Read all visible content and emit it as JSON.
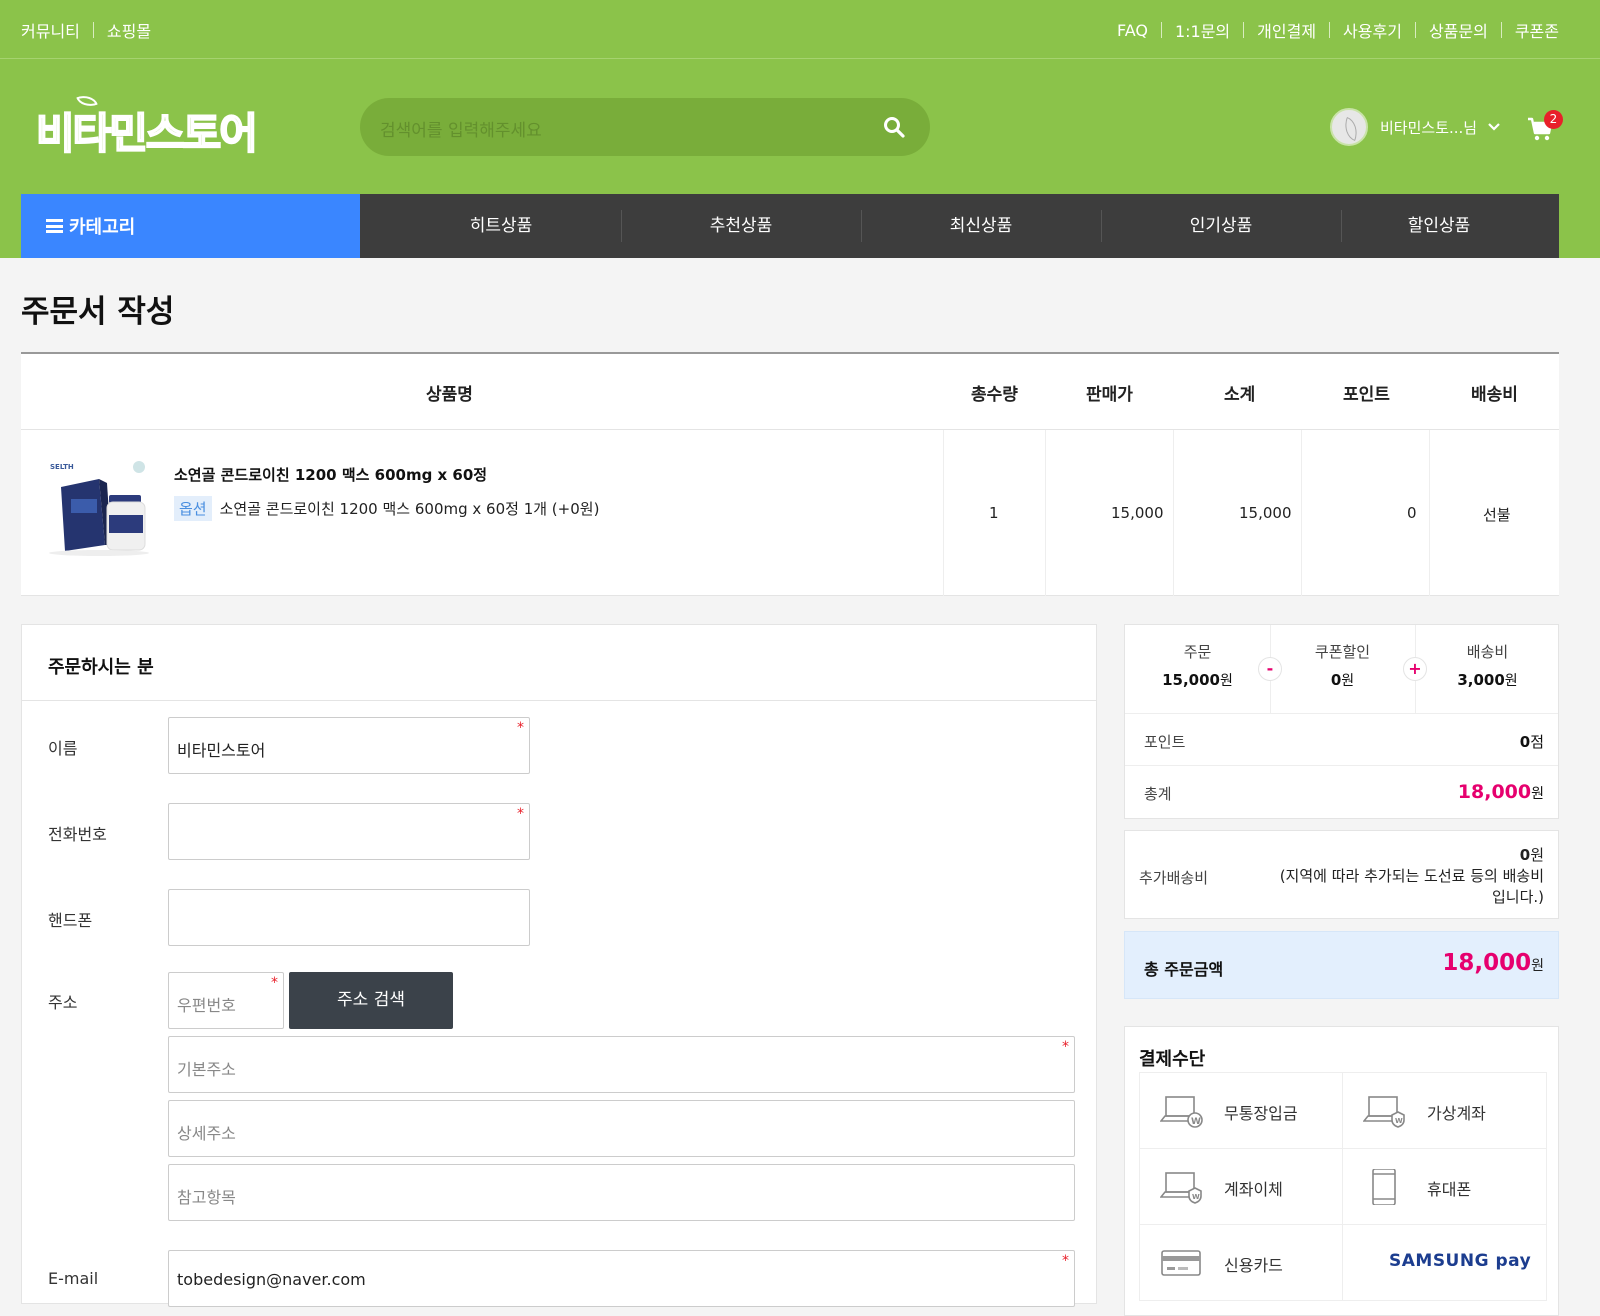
{
  "topbar": {
    "left_links": [
      "커뮤니티",
      "쇼핑몰"
    ],
    "right_links": [
      "FAQ",
      "1:1문의",
      "개인결제",
      "사용후기",
      "상품문의",
      "쿠폰존"
    ]
  },
  "header": {
    "logo_text": "비타민스토어",
    "search_placeholder": "검색어를 입력해주세요",
    "user_name": "비타민스토...님",
    "cart_count": "2"
  },
  "nav": {
    "category_label": "카테고리",
    "items": [
      "히트상품",
      "추천상품",
      "최신상품",
      "인기상품",
      "할인상품"
    ]
  },
  "page": {
    "title": "주문서 작성"
  },
  "product_table": {
    "headers": [
      "상품명",
      "총수량",
      "판매가",
      "소계",
      "포인트",
      "배송비"
    ],
    "rows": [
      {
        "name": "소연골 콘드로이친 1200 맥스 600mg x 60정",
        "option_tag": "옵션",
        "option_text": "소연골 콘드로이친 1200 맥스 600mg x 60정 1개 (+0원)",
        "qty": "1",
        "price": "15,000",
        "subtotal": "15,000",
        "point": "0",
        "shipping": "선불"
      }
    ]
  },
  "orderer": {
    "title": "주문하시는 분",
    "labels": {
      "name": "이름",
      "phone": "전화번호",
      "mobile": "핸드폰",
      "address": "주소",
      "email": "E-mail"
    },
    "values": {
      "name": "비타민스토어",
      "phone": "",
      "mobile": "",
      "email": "tobedesign@naver.com"
    },
    "placeholders": {
      "zip": "우편번호",
      "addr1": "기본주소",
      "addr2": "상세주소",
      "addr3": "참고항목"
    },
    "address_search_button": "주소 검색",
    "required_mark": "*"
  },
  "summary": {
    "order_label": "주문",
    "order_value": "15,000",
    "coupon_label": "쿠폰할인",
    "coupon_value": "0",
    "ship_label": "배송비",
    "ship_value": "3,000",
    "won": "원",
    "minus": "-",
    "plus": "+",
    "point_label": "포인트",
    "point_value": "0",
    "point_unit": "점",
    "total_label": "총계",
    "total_value": "18,000"
  },
  "extra_shipping": {
    "label": "추가배송비",
    "value": "0",
    "note_line1": "(지역에 따라 추가되는 도선료 등의 배송비",
    "note_line2": "입니다.)"
  },
  "grand_total": {
    "label": "총 주문금액",
    "value": "18,000"
  },
  "payment": {
    "title": "결제수단",
    "methods": [
      "무통장입금",
      "가상계좌",
      "계좌이체",
      "휴대폰",
      "신용카드"
    ],
    "samsung_pay": "SAMSUNG pay"
  },
  "colors": {
    "brand_green": "#8bc34a",
    "nav_dark": "#3d3d3d",
    "category_blue": "#3a86ff",
    "accent_pink": "#e6006e"
  }
}
